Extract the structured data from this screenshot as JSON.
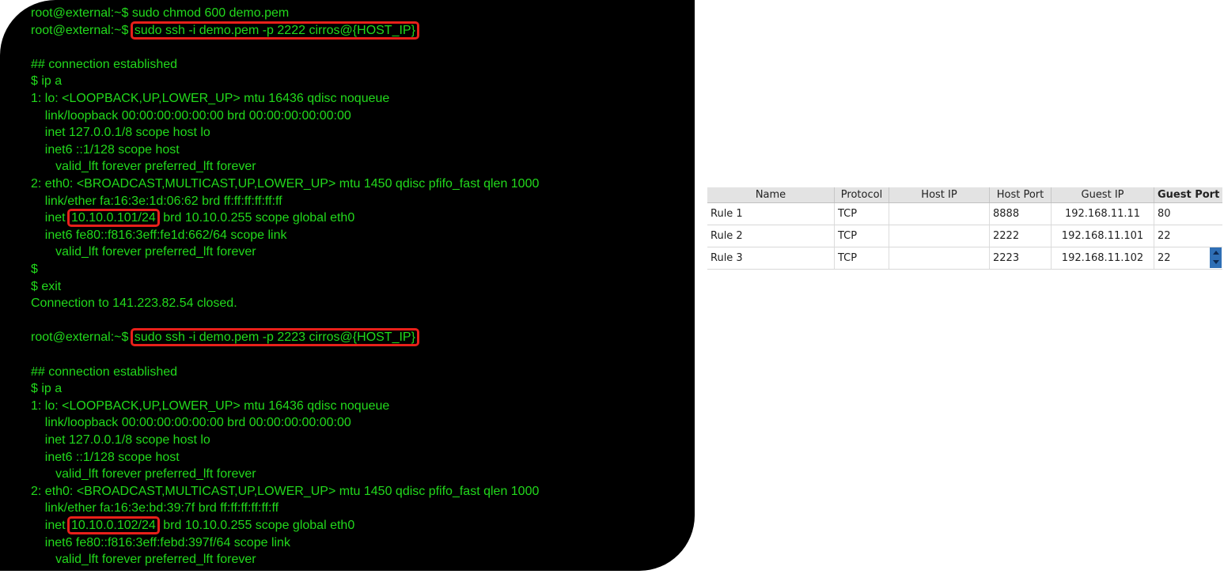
{
  "terminal": {
    "lines": [
      {
        "t": "root@external:~$ sudo chmod 600 demo.pem"
      },
      {
        "t": "root@external:~$ ",
        "h": "sudo ssh -i demo.pem -p 2222 cirros@{HOST_IP}"
      },
      {
        "t": ""
      },
      {
        "t": "## connection established"
      },
      {
        "t": "$ ip a"
      },
      {
        "t": "1: lo: <LOOPBACK,UP,LOWER_UP> mtu 16436 qdisc noqueue"
      },
      {
        "t": "    link/loopback 00:00:00:00:00:00 brd 00:00:00:00:00:00"
      },
      {
        "t": "    inet 127.0.0.1/8 scope host lo"
      },
      {
        "t": "    inet6 ::1/128 scope host"
      },
      {
        "t": "       valid_lft forever preferred_lft forever"
      },
      {
        "t": "2: eth0: <BROADCAST,MULTICAST,UP,LOWER_UP> mtu 1450 qdisc pfifo_fast qlen 1000"
      },
      {
        "t": "    link/ether fa:16:3e:1d:06:62 brd ff:ff:ff:ff:ff:ff"
      },
      {
        "t": "    inet ",
        "h": "10.10.0.101/24",
        "a": " brd 10.10.0.255 scope global eth0"
      },
      {
        "t": "    inet6 fe80::f816:3eff:fe1d:662/64 scope link"
      },
      {
        "t": "       valid_lft forever preferred_lft forever"
      },
      {
        "t": "$"
      },
      {
        "t": "$ exit"
      },
      {
        "t": "Connection to 141.223.82.54 closed."
      },
      {
        "t": ""
      },
      {
        "t": "root@external:~$ ",
        "h": "sudo ssh -i demo.pem -p 2223 cirros@{HOST_IP}"
      },
      {
        "t": ""
      },
      {
        "t": "## connection established"
      },
      {
        "t": "$ ip a"
      },
      {
        "t": "1: lo: <LOOPBACK,UP,LOWER_UP> mtu 16436 qdisc noqueue"
      },
      {
        "t": "    link/loopback 00:00:00:00:00:00 brd 00:00:00:00:00:00"
      },
      {
        "t": "    inet 127.0.0.1/8 scope host lo"
      },
      {
        "t": "    inet6 ::1/128 scope host"
      },
      {
        "t": "       valid_lft forever preferred_lft forever"
      },
      {
        "t": "2: eth0: <BROADCAST,MULTICAST,UP,LOWER_UP> mtu 1450 qdisc pfifo_fast qlen 1000"
      },
      {
        "t": "    link/ether fa:16:3e:bd:39:7f brd ff:ff:ff:ff:ff:ff"
      },
      {
        "t": "    inet ",
        "h": "10.10.0.102/24",
        "a": " brd 10.10.0.255 scope global eth0"
      },
      {
        "t": "    inet6 fe80::f816:3eff:febd:397f/64 scope link"
      },
      {
        "t": "       valid_lft forever preferred_lft forever"
      }
    ],
    "colors": {
      "text": "#22d91c",
      "background": "#000000",
      "highlight_border": "#e8201a"
    }
  },
  "port_forwarding": {
    "headers": {
      "name": "Name",
      "protocol": "Protocol",
      "host_ip": "Host IP",
      "host_port": "Host Port",
      "guest_ip": "Guest IP",
      "guest_port": "Guest Port"
    },
    "rules": [
      {
        "name": "Rule 1",
        "protocol": "TCP",
        "host_ip": "",
        "host_port": "8888",
        "guest_ip": "192.168.11.11",
        "guest_port": "80"
      },
      {
        "name": "Rule 2",
        "protocol": "TCP",
        "host_ip": "",
        "host_port": "2222",
        "guest_ip": "192.168.11.101",
        "guest_port": "22"
      },
      {
        "name": "Rule 3",
        "protocol": "TCP",
        "host_ip": "",
        "host_port": "2223",
        "guest_ip": "192.168.11.102",
        "guest_port": "22"
      }
    ]
  }
}
